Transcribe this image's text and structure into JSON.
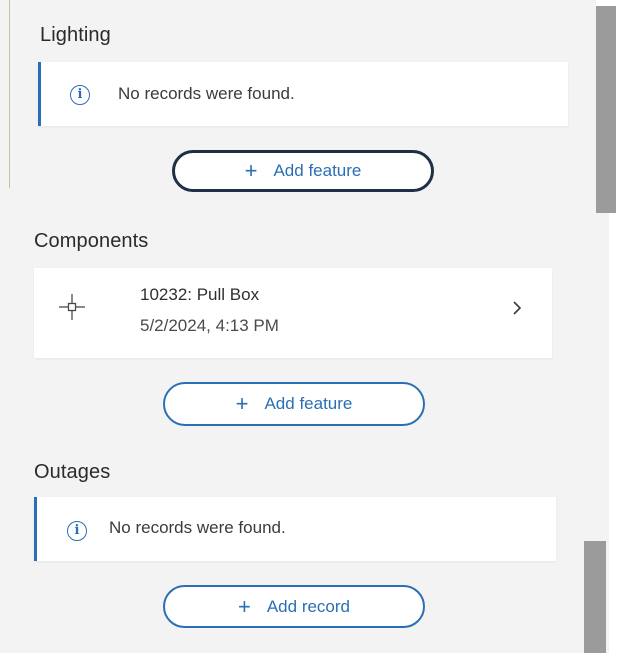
{
  "lighting": {
    "title": "Lighting",
    "notice": "No records were found.",
    "add_label": "Add feature"
  },
  "components": {
    "title": "Components",
    "records": [
      {
        "title": "10232: Pull Box",
        "date": "5/2/2024, 4:13 PM"
      }
    ],
    "add_label": "Add feature"
  },
  "outages": {
    "title": "Outages",
    "notice": "No records were found.",
    "add_label": "Add record"
  },
  "icons": {
    "info": "info-icon",
    "plus": "plus-icon",
    "point": "point-feature-icon",
    "chevron": "chevron-right-icon"
  },
  "colors": {
    "accent": "#2a6fb5",
    "panel_bg": "#f3f3f3",
    "scrollbar": "#9b9b9b"
  }
}
